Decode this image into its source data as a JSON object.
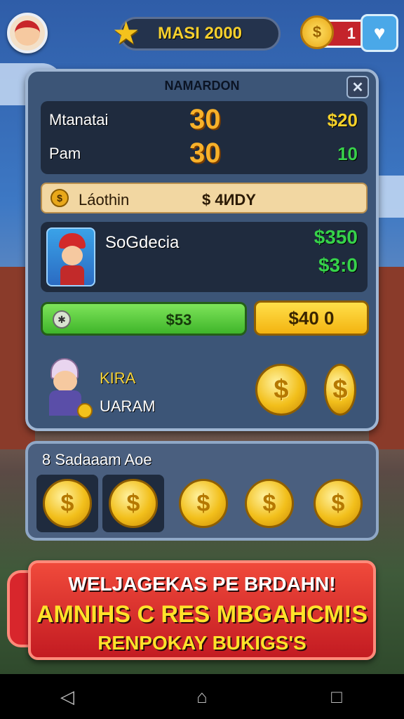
{
  "header": {
    "score_text": "MASI 2000",
    "coin_count": "1",
    "coin_symbol": "$"
  },
  "panel": {
    "title": "NAMARDON",
    "close_symbol": "✕",
    "stats": [
      {
        "name": "Mtanatai",
        "big": "30",
        "money": "$20"
      },
      {
        "name": "Pam",
        "big": "30",
        "money": "10"
      }
    ],
    "loot": {
      "icon": "$",
      "label": "Láothin",
      "value": "$ 4ИDY"
    },
    "character": {
      "name": "SoGdecia",
      "value1": "$350",
      "value2": "$3:0"
    },
    "green_button": {
      "label": "$53"
    },
    "yellow_button": {
      "label": "$40 0"
    },
    "npc": {
      "name": "KIRA",
      "subtitle": "UARAM"
    },
    "coin_symbol": "$"
  },
  "panel2": {
    "title": "8 Sadaaam Aoe",
    "coin_symbol": "$"
  },
  "banner": {
    "line1": "WELJAGEKAS PE BRDAHN!",
    "line2": "AMNIHS C RES MBGAHCM!S",
    "line3": "RENPOKAY BUKIGS'S"
  },
  "nav": {
    "back": "◁",
    "home": "⌂",
    "recent": "□"
  },
  "colors": {
    "accent_gold": "#f4c21c",
    "money_green": "#36d24a",
    "banner_red": "#d8262c"
  }
}
